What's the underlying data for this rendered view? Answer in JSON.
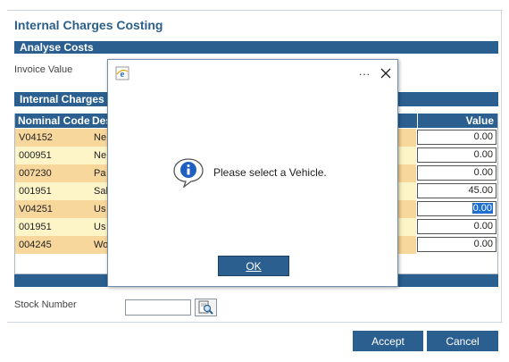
{
  "page": {
    "title": "Internal Charges Costing"
  },
  "analyse": {
    "header": "Analyse Costs",
    "invoice_label": "Invoice Value"
  },
  "charges": {
    "header": "Internal Charges",
    "columns": {
      "code": "Nominal Code",
      "desc": "Description",
      "value": "Value"
    },
    "rows": [
      {
        "code": "V04152",
        "desc": "Ne",
        "value": "0.00",
        "bg": "#f7d79b"
      },
      {
        "code": "000951",
        "desc": "Ne",
        "value": "0.00",
        "bg": "#fdf5c8"
      },
      {
        "code": "007230",
        "desc": "Pa",
        "value": "0.00",
        "bg": "#f7d79b"
      },
      {
        "code": "001951",
        "desc": "Sal",
        "value": "45.00",
        "bg": "#fdf5c8"
      },
      {
        "code": "V04251",
        "desc": "Us",
        "value": "0.00",
        "bg": "#f7d79b"
      },
      {
        "code": "001951",
        "desc": "Us",
        "value": "0.00",
        "bg": "#fdf5c8"
      },
      {
        "code": "004245",
        "desc": "Wo",
        "value": "0.00",
        "bg": "#f7d79b"
      }
    ],
    "selected_row_index": 4
  },
  "stock": {
    "label": "Stock Number",
    "value": ""
  },
  "buttons": {
    "accept": "Accept",
    "cancel": "Cancel"
  },
  "dialog": {
    "title": "",
    "more": "...",
    "message": "Please select a Vehicle.",
    "ok": "OK",
    "icon": "info-icon"
  },
  "colors": {
    "brand": "#2a5f8f",
    "row_dark": "#f7d79b",
    "row_light": "#fdf5c8"
  }
}
